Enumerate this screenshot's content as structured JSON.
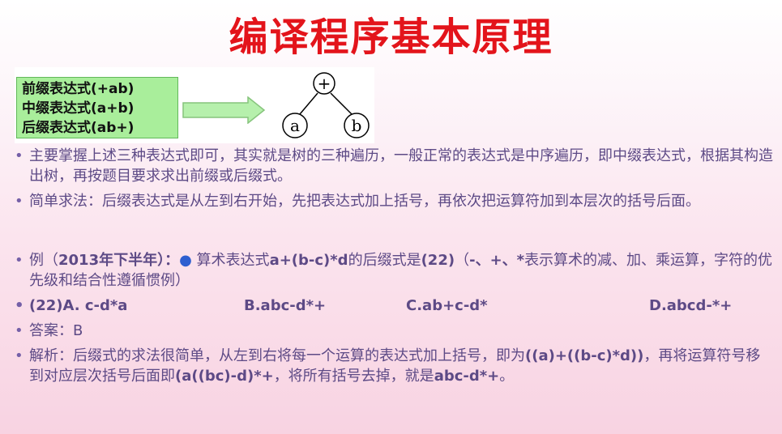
{
  "title": "编译程序基本原理",
  "figure": {
    "expressions": [
      "前缀表达式(+ab)",
      "中缀表达式(a+b)",
      "后缀表达式(ab+)"
    ],
    "tree": {
      "root": "+",
      "left": "a",
      "right": "b"
    }
  },
  "bullets": {
    "b1": "主要掌握上述三种表达式即可，其实就是树的三种遍历，一般正常的表达式是中序遍历，即中缀表达式，根据其构造出树，再按题目要求求出前缀或后缀式。",
    "b2": "简单求法：后缀表达式是从左到右开始，先把表达式加上括号，再依次把运算符加到本层次的括号后面。",
    "b3": {
      "prefix": "例（",
      "year": "2013年下半年）：",
      "dot": "●",
      "text1": " 算术表达式",
      "expr": "a+(b-c)*d",
      "text2": "的后缀式是",
      "blank": "(22)",
      "text3": "（",
      "ops": "-、+、*",
      "text4": "表示算术的减、加、乘运算，字符的优先级和结合性遵循惯例）"
    },
    "options": {
      "a": "(22)A.    c-d*a",
      "b": "B.abc-d*+",
      "c": "C.ab+c-d*",
      "d": "D.abcd-*+"
    },
    "answer": "答案：B",
    "b6": {
      "t1": "解析：后缀式的求法很简单，从左到右将每一个运算的表达式加上括号，即为",
      "e1": "((a)+((b-c)*d))",
      "t2": "，再将运算符号移到对应层次括号后面即",
      "e2": "(a((bc)-d)*+",
      "t3": "，将所有括号去掉，就是",
      "e3": "abc-d*+",
      "t4": "。"
    }
  },
  "colors": {
    "title": "#e3141b",
    "body_text": "#5d4a86",
    "expr_box": "#a9ee9b",
    "arrow": "#b6f0ac",
    "bullet_dot": "#2e5fd0"
  }
}
